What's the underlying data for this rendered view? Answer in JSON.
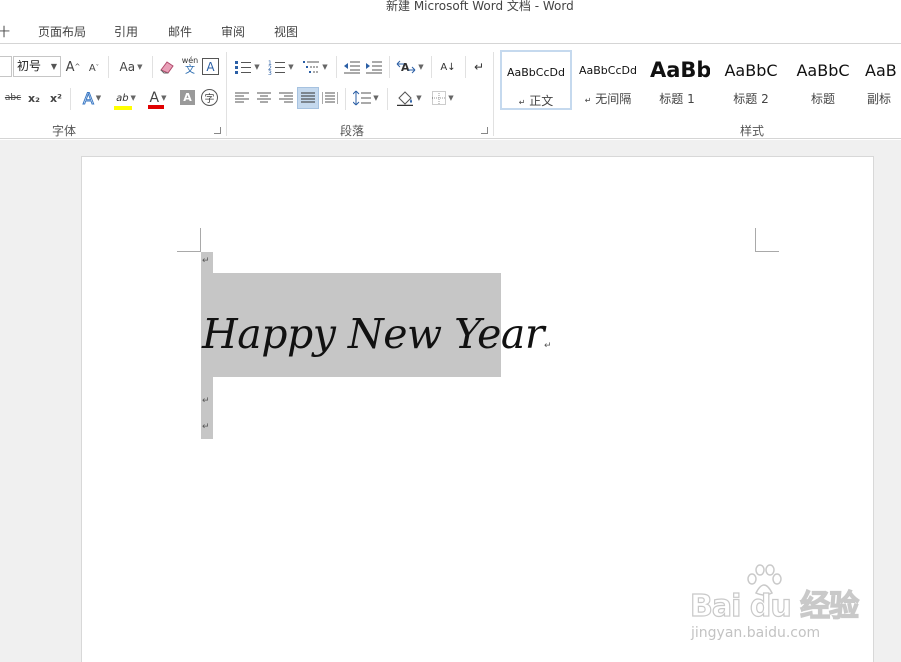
{
  "window": {
    "title": "新建 Microsoft Word 文档 - Word"
  },
  "tabs": [
    {
      "label": "十"
    },
    {
      "label": "页面布局"
    },
    {
      "label": "引用"
    },
    {
      "label": "邮件"
    },
    {
      "label": "审阅"
    },
    {
      "label": "视图"
    }
  ],
  "font_group": {
    "font_size_value": "初号",
    "grow_glyph": "A",
    "shrink_glyph": "A",
    "change_case_label": "Aa",
    "phonetic_top": "wén",
    "phonetic_bottom": "文",
    "border_glyph": "A",
    "strike_label": "abc",
    "subscript_label": "x₂",
    "superscript_label": "x²",
    "effects_glyph": "A",
    "highlight_glyph": "ab",
    "font_color_glyph": "A",
    "shade_glyph": "A",
    "enclose_glyph": "字",
    "label": "字体",
    "highlight_color": "#ffff00",
    "font_color": "#e00000"
  },
  "paragraph_group": {
    "sort_glyph": "A↓",
    "label": "段落"
  },
  "styles_group": {
    "label": "样式",
    "items": [
      {
        "preview": "AaBbCcDd",
        "name": "正文",
        "mark": "↵"
      },
      {
        "preview": "AaBbCcDd",
        "name": "无间隔",
        "mark": "↵"
      },
      {
        "preview": "AaBb",
        "name": "标题 1"
      },
      {
        "preview": "AaBbC",
        "name": "标题 2"
      },
      {
        "preview": "AaBbC",
        "name": "标题"
      },
      {
        "preview": "AaB",
        "name": "副标"
      }
    ]
  },
  "document": {
    "text": "Happy New Year",
    "paragraph_mark": "↵",
    "selection_color": "#c6c6c6"
  },
  "watermark": {
    "logo": "Bai du 经验",
    "url": "jingyan.baidu.com"
  }
}
